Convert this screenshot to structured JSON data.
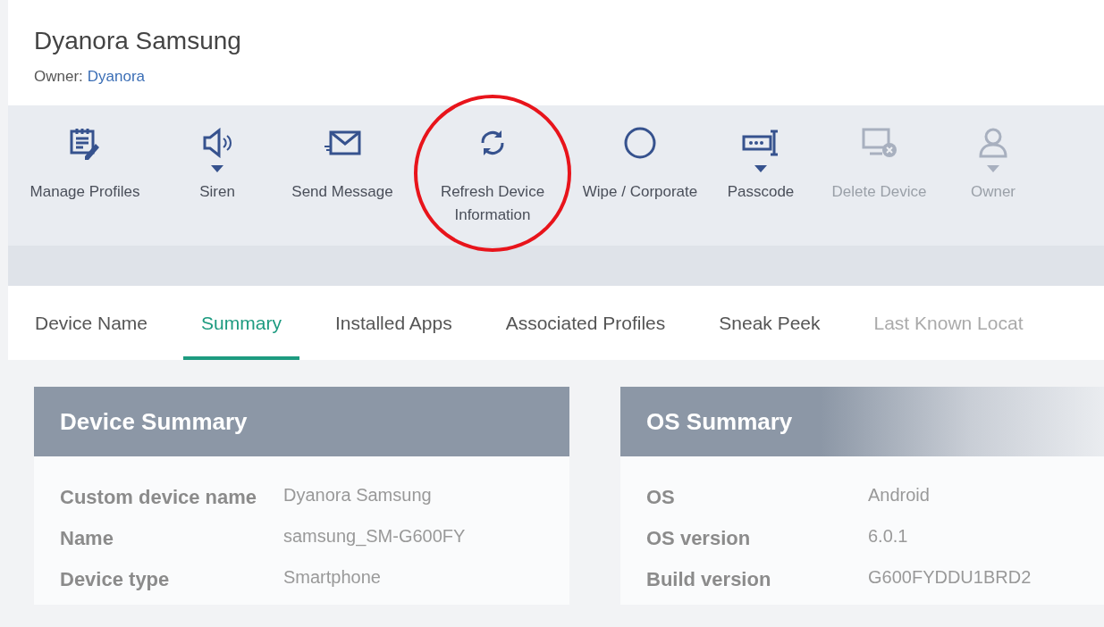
{
  "header": {
    "title": "Dyanora Samsung",
    "owner_label": "Owner:",
    "owner_name": "Dyanora"
  },
  "toolbar": [
    {
      "label": "Manage Profiles",
      "disabled": false,
      "has_menu": false
    },
    {
      "label": "Siren",
      "disabled": false,
      "has_menu": true
    },
    {
      "label": "Send Message",
      "disabled": false,
      "has_menu": false
    },
    {
      "label": "Refresh Device Information",
      "disabled": false,
      "has_menu": false,
      "highlighted": true
    },
    {
      "label": "Wipe / Corporate",
      "disabled": false,
      "has_menu": false
    },
    {
      "label": "Passcode",
      "disabled": false,
      "has_menu": true
    },
    {
      "label": "Delete Device",
      "disabled": true,
      "has_menu": false
    },
    {
      "label": "Owner",
      "disabled": true,
      "has_menu": true
    }
  ],
  "tabs": [
    {
      "label": "Device Name",
      "selected": false
    },
    {
      "label": "Summary",
      "selected": true
    },
    {
      "label": "Installed Apps",
      "selected": false
    },
    {
      "label": "Associated Profiles",
      "selected": false
    },
    {
      "label": "Sneak Peek",
      "selected": false
    },
    {
      "label": "Last Known Locat",
      "selected": false
    }
  ],
  "cards": [
    {
      "title": "Device Summary",
      "rows": [
        {
          "label": "Custom device name",
          "value": "Dyanora Samsung"
        },
        {
          "label": "Name",
          "value": "samsung_SM-G600FY"
        },
        {
          "label": "Device type",
          "value": "Smartphone"
        }
      ]
    },
    {
      "title": "OS Summary",
      "rows": [
        {
          "label": "OS",
          "value": "Android"
        },
        {
          "label": "OS version",
          "value": "6.0.1"
        },
        {
          "label": "Build version",
          "value": "G600FYDDU1BRD2"
        }
      ]
    }
  ]
}
